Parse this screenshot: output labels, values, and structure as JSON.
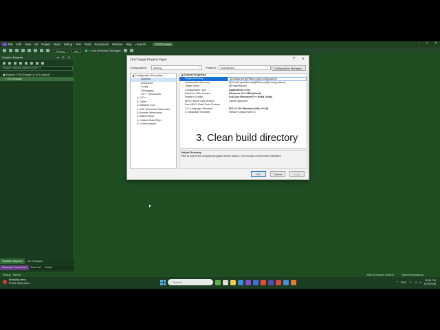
{
  "menubar": {
    "items": [
      "File",
      "Edit",
      "View",
      "Git",
      "Project",
      "Build",
      "Debug",
      "Test",
      "Tools",
      "Extensions",
      "Window",
      "Help"
    ],
    "search_label": "Search",
    "solution_title": "CPUTriangle"
  },
  "toolbar": {
    "config": "Debug",
    "platform": "x64",
    "run_label": "Local Windows Debugger"
  },
  "solution_explorer": {
    "title": "Solution Explorer",
    "search_placeholder": "Search Solution Explorer (Ctrl+;)",
    "solution_row": "Solution 'CPUTriangle' (1 of 1 project)",
    "project_row": "CPUTriangle",
    "tabs": [
      "Solution Explorer",
      "Git Changes"
    ]
  },
  "bottom_tabs": [
    "Developer PowerShell",
    "Error List",
    "Output"
  ],
  "status": {
    "ready": "Ready",
    "saved": "Saved",
    "source_control": "Add to Source Control",
    "repository": "Select Repository"
  },
  "dialog": {
    "title": "CPUTriangle Property Pages",
    "config_label": "Configuration:",
    "config_value": "Debug",
    "platform_label": "Platform:",
    "platform_value": "Active(x64)",
    "config_manager": "Configuration Manager...",
    "tree": [
      "Configuration Properties",
      "General",
      "Advanced",
      "vcpkg",
      "Debugging",
      "VC++ Directories",
      "C/C++",
      "Linker",
      "Manifest Tool",
      "XML Document Generator",
      "Browse Information",
      "Build Events",
      "Custom Build Step",
      "Code Analysis"
    ],
    "grid_header": "General Properties",
    "grid": [
      {
        "k": "Output Directory",
        "v": "$(SolutionDir)$(Platform)\\$(Configuration)\\"
      },
      {
        "k": "Intermediate Directory",
        "v": "$(ShortProjectName)\\$(Platform)\\$(Configuration)\\"
      },
      {
        "k": "Target Name",
        "v": "$(ProjectName)"
      },
      {
        "k": "Configuration Type",
        "v": "Application (.exe)"
      },
      {
        "k": "Windows SDK Version",
        "v": "Windows 10.0 SDK (latest)"
      },
      {
        "k": "Platform Toolset",
        "v": "v143 (for Microsoft C++ Build Tools)"
      },
      {
        "k": "MSVC Build Tools Version",
        "v": "Latest supported"
      },
      {
        "k": "Use MSVC Build Tools Preview",
        "v": ""
      },
      {
        "k": "C++ Language Standard",
        "v": "ISO C++20 Standard (/std:c++20)"
      },
      {
        "k": "C Language Standard",
        "v": "Default (Legacy MSVC)"
      }
    ],
    "caption": "3. Clean build directory",
    "desc_title": "Output Directory",
    "desc_text": "Path to where the compiled program will be placed. Can include environment variables.",
    "ok": "OK",
    "cancel": "Cancel",
    "apply": "Apply"
  },
  "taskbar": {
    "news_title": "Breaking news",
    "news_sub": "Prince Harry and...",
    "search_placeholder": "Search",
    "lang": "ENG",
    "time": "10:26 PM",
    "date": "8/13/2026"
  },
  "colors": {
    "desktop": "#1e4d22",
    "selection": "#1a6fd4",
    "accent": "#7b4fc8"
  }
}
